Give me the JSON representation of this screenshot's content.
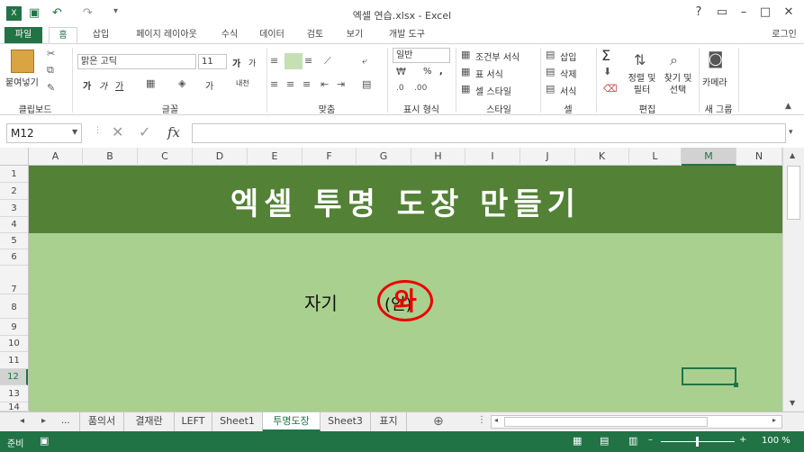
{
  "window": {
    "title": "엑셀 연습.xlsx - Excel",
    "help": "?",
    "restore_ribbon": "▭",
    "minimize": "–",
    "maximize": "□",
    "close": "✕"
  },
  "quick_access": {
    "save": "▣",
    "undo": "↶",
    "redo": "↷",
    "more": "▾"
  },
  "tabs": [
    {
      "label": "파일"
    },
    {
      "label": "홈"
    },
    {
      "label": "삽입"
    },
    {
      "label": "페이지 레이아웃"
    },
    {
      "label": "수식"
    },
    {
      "label": "데이터"
    },
    {
      "label": "검토"
    },
    {
      "label": "보기"
    },
    {
      "label": "개발 도구"
    }
  ],
  "signin": "로그인",
  "ribbon": {
    "clipboard": {
      "paste": "붙여넣기",
      "label": "클립보드"
    },
    "font": {
      "name": "맑은 고딕",
      "size": "11",
      "label": "글꼴",
      "grow": "가",
      "shrink": "가",
      "bold": "가",
      "italic": "가",
      "underline": "가",
      "color": "가",
      "phonetic": "내천"
    },
    "align": {
      "label": "맞춤"
    },
    "number": {
      "format": "일반",
      "percent": "%",
      "comma": ",",
      "label": "표시 형식"
    },
    "styles": {
      "conditional": "조건부 서식",
      "table": "표 서식",
      "cell": "셀 스타일",
      "label": "스타일"
    },
    "cells": {
      "insert": "삽입",
      "delete": "삭제",
      "format": "서식",
      "label": "셀"
    },
    "editing": {
      "sum": "Σ",
      "sort": "정렬 및 필터",
      "find": "찾기 및 선택",
      "label": "편집"
    },
    "camera": {
      "name": "카메라",
      "label": "새 그룹"
    }
  },
  "formula_bar": {
    "name_box": "M12",
    "fx": "fx",
    "value": ""
  },
  "columns": [
    "A",
    "B",
    "C",
    "D",
    "E",
    "F",
    "G",
    "H",
    "I",
    "J",
    "K",
    "L",
    "M",
    "N"
  ],
  "rows": [
    "1",
    "2",
    "3",
    "4",
    "5",
    "6",
    "7",
    "8",
    "9",
    "10",
    "11",
    "12",
    "13",
    "14"
  ],
  "cells": {
    "title": "엑셀 투명 도장 만들기",
    "self_label": "자기",
    "paren": "(인)",
    "stamp_char": "와"
  },
  "sheet_tabs": [
    {
      "label": "품의서"
    },
    {
      "label": "결재란"
    },
    {
      "label": "LEFT"
    },
    {
      "label": "Sheet1"
    },
    {
      "label": "투명도장"
    },
    {
      "label": "Sheet3"
    },
    {
      "label": "표지"
    }
  ],
  "sheet_nav": {
    "prev": "◂",
    "next": "▸",
    "more": "...",
    "add": "⊕"
  },
  "status": {
    "ready": "준비",
    "zoom": "100 %",
    "minus": "–",
    "plus": "+"
  },
  "colors": {
    "excel_green": "#217346",
    "title_band": "#538135",
    "body": "#a9d08e",
    "stamp": "#e00000"
  }
}
